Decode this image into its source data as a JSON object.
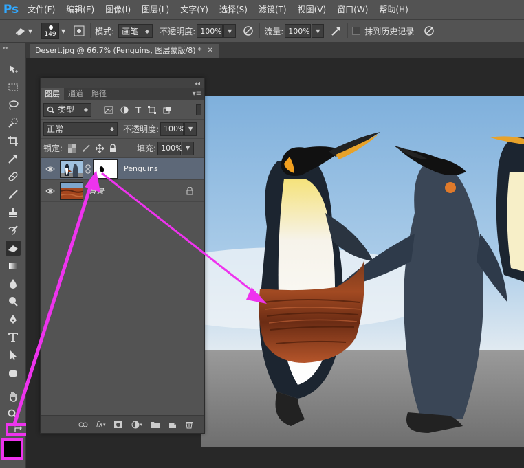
{
  "app": {
    "logo": "Ps"
  },
  "menu": [
    "文件(F)",
    "编辑(E)",
    "图像(I)",
    "图层(L)",
    "文字(Y)",
    "选择(S)",
    "滤镜(T)",
    "视图(V)",
    "窗口(W)",
    "帮助(H)"
  ],
  "options": {
    "brush_size": "149",
    "mode_label": "模式:",
    "mode_value": "画笔",
    "opacity_label": "不透明度:",
    "opacity_value": "100%",
    "flow_label": "流量:",
    "flow_value": "100%",
    "erase_history_label": "抹到历史记录"
  },
  "document": {
    "tab_title": "Desert.jpg @ 66.7% (Penguins, 图层蒙版/8) *"
  },
  "layers_panel": {
    "tabs": [
      "图层",
      "通道",
      "路径"
    ],
    "filter_label": "类型",
    "blend_mode": "正常",
    "opacity_label": "不透明度:",
    "opacity_value": "100%",
    "lock_label": "锁定:",
    "fill_label": "填充:",
    "fill_value": "100%",
    "layers": [
      {
        "name": "Penguins",
        "selected": true,
        "has_mask": true
      },
      {
        "name": "背景",
        "selected": false,
        "locked": true
      }
    ]
  },
  "colors": {
    "annotation": "#ee33ee",
    "foreground": "#000000",
    "selected_layer": "#5d6878"
  },
  "icons": [
    "eraser-icon",
    "brush-picker-icon",
    "airbrush-icon",
    "pressure-icon",
    "eye-icon",
    "lock-icon",
    "link-icon",
    "fx-icon",
    "mask-icon",
    "adjustment-icon",
    "folder-icon",
    "new-layer-icon",
    "trash-icon"
  ]
}
